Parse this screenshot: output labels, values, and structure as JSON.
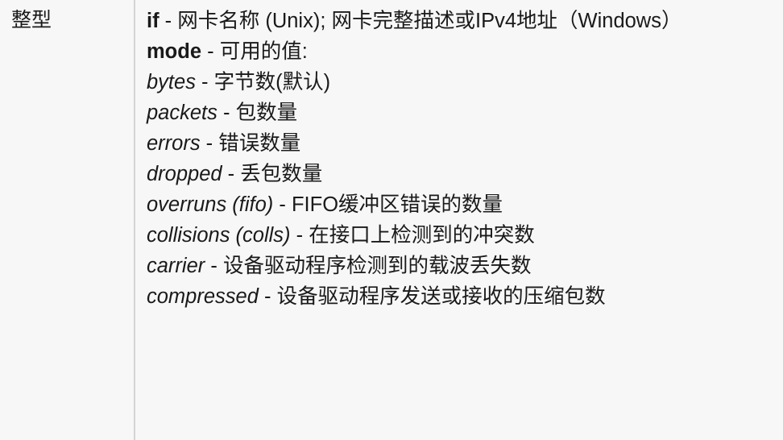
{
  "type_cell": {
    "label": "整型"
  },
  "description": {
    "params": [
      {
        "key": "if",
        "sep": " - ",
        "desc": "网卡名称 (Unix); 网卡完整描述或IPv4地址（Windows）"
      },
      {
        "key": "mode",
        "sep": " - ",
        "desc": "可用的值:"
      }
    ],
    "mode_values": [
      {
        "key": "bytes",
        "sep": " - ",
        "desc": "字节数(默认)"
      },
      {
        "key": "packets",
        "sep": " - ",
        "desc": "包数量"
      },
      {
        "key": "errors",
        "sep": " - ",
        "desc": "错误数量"
      },
      {
        "key": "dropped",
        "sep": " - ",
        "desc": "丢包数量"
      },
      {
        "key": "overruns (fifo)",
        "sep": " - ",
        "desc": "FIFO缓冲区错误的数量"
      },
      {
        "key": "collisions (colls)",
        "sep": " - ",
        "desc": "在接口上检测到的冲突数"
      },
      {
        "key": "carrier",
        "sep": " - ",
        "desc": "设备驱动程序检测到的载波丢失数"
      },
      {
        "key": "compressed",
        "sep": " - ",
        "desc": "设备驱动程序发送或接收的压缩包数"
      }
    ]
  }
}
